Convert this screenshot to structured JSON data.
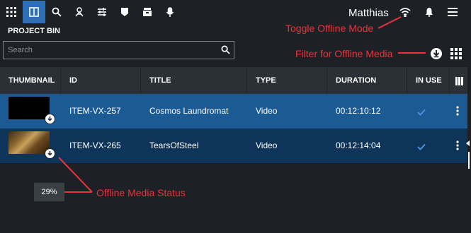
{
  "toolbar": {
    "icons": [
      "apps-grid-icon",
      "bin-panel-icon",
      "search-icon",
      "media-tools-icon",
      "sliders-icon",
      "marker-icon",
      "inbox-icon",
      "microphone-icon"
    ],
    "active_index": 1,
    "username": "Matthias",
    "right_icons": [
      "wifi-icon",
      "bell-icon",
      "hamburger-menu-icon"
    ]
  },
  "bin": {
    "title": "PROJECT BIN",
    "search_placeholder": "Search"
  },
  "table": {
    "columns": [
      "THUMBNAIL",
      "ID",
      "TITLE",
      "TYPE",
      "DURATION",
      "IN USE"
    ],
    "rows": [
      {
        "id": "ITEM-VX-257",
        "title": "Cosmos Laundromat",
        "type": "Video",
        "duration": "00:12:10:12",
        "in_use": true
      },
      {
        "id": "ITEM-VX-265",
        "title": "TearsOfSteel",
        "type": "Video",
        "duration": "00:12:14:04",
        "in_use": true
      }
    ]
  },
  "offline_status": {
    "progress_label": "29%",
    "progress": 0.29
  },
  "annotations": {
    "toggle_offline": "Toggle Offline Mode",
    "filter_offline": "Filter for Offline Media",
    "offline_status": "Offline Media Status"
  },
  "colors": {
    "accent": "#2f6fb5",
    "row_selected": "#1c5a94",
    "row_alt": "#0e3559",
    "annotation": "#e8343b",
    "check": "#4a90d9"
  }
}
